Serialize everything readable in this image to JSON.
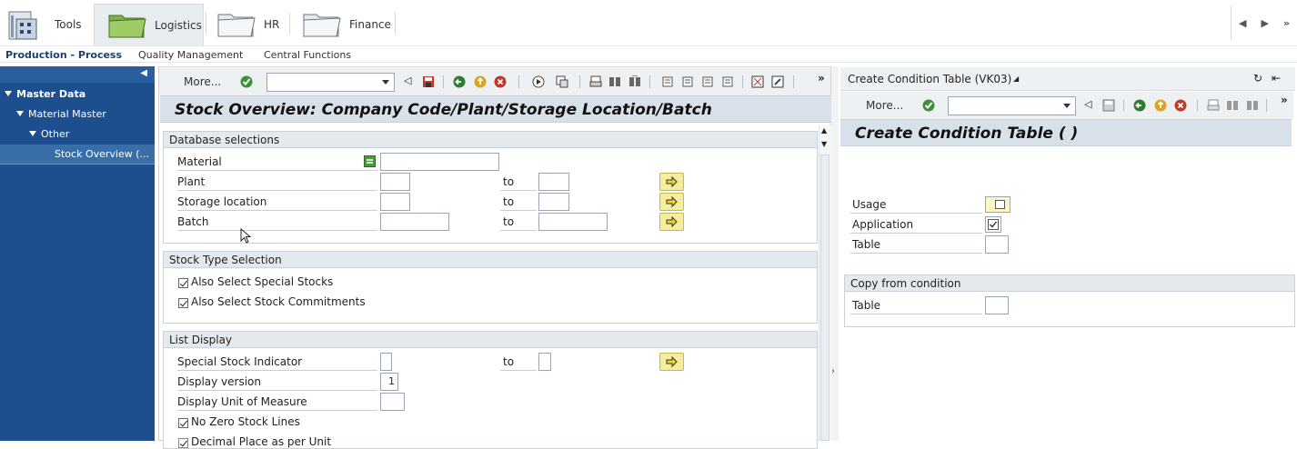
{
  "launch_tabs": [
    {
      "label": "Tools",
      "icon": "building-icon"
    },
    {
      "label": "Logistics",
      "icon": "folder-icon",
      "active": true
    },
    {
      "label": "HR",
      "icon": "folder-icon"
    },
    {
      "label": "Finance",
      "icon": "folder-icon"
    }
  ],
  "secondary_nav": [
    "Production - Process",
    "Quality Management",
    "Central Functions"
  ],
  "sidebar": {
    "items": [
      "Master Data",
      "Material Master",
      "Other",
      "Stock Overview (..."
    ]
  },
  "main": {
    "toolbar": {
      "more_label": "More..."
    },
    "title": "Stock Overview: Company Code/Plant/Storage Location/Batch",
    "db_selections": {
      "header": "Database selections",
      "material": "Material",
      "plant": "Plant",
      "storage_location": "Storage location",
      "batch": "Batch",
      "to": "to"
    },
    "stock_type": {
      "header": "Stock Type Selection",
      "special_stocks": "Also Select Special Stocks",
      "stock_commitments": "Also Select Stock Commitments"
    },
    "list_display": {
      "header": "List Display",
      "special_stock_indicator": "Special Stock Indicator",
      "to": "to",
      "display_version": "Display version",
      "display_version_value": "1",
      "display_uom": "Display Unit of Measure",
      "no_zero": "No Zero Stock Lines",
      "decimal": "Decimal Place as per Unit"
    }
  },
  "right": {
    "header": "Create Condition Table (VK03)",
    "toolbar": {
      "more_label": "More..."
    },
    "title": "Create Condition Table ( )",
    "usage": "Usage",
    "application": "Application",
    "table": "Table",
    "copy_header": "Copy from condition",
    "copy_table": "Table"
  },
  "colors": {
    "sidebar": "#1d4f8e",
    "title_bar": "#d8e1ea",
    "accent_button": "#f6ee9f"
  }
}
